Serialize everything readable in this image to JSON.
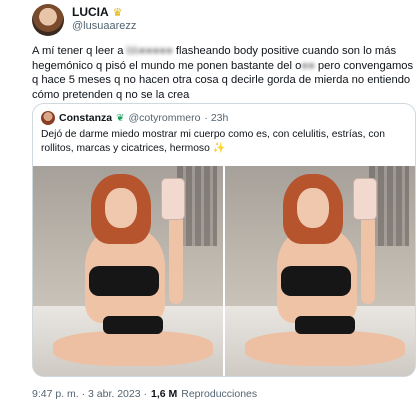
{
  "tweet": {
    "display_name": "LUCIA",
    "handle": "@lusuaarezz",
    "text_part1": "A mí tener q leer a ",
    "text_blur1": "b",
    "text_part2": " flasheando body positive cuando son lo más hegemónico q pisó el mundo me ponen bastante del o",
    "text_blur2": "",
    "text_part3": " pero convengamos q hace 5 meses q no hacen otra cosa q decirle gorda de mierda no entiendo cómo pretenden q no se la crea",
    "timestamp": "9:47 p. m. · 3 abr. 2023 ·",
    "views_count": "1,6 M",
    "views_label": "Reproducciones",
    "icons": {
      "crown": "crown-icon"
    }
  },
  "quote": {
    "display_name": "Constanza",
    "handle": "@cotyrommero",
    "age": "· 23h",
    "text": "Dejó de darme miedo mostrar mi cuerpo como es, con celulitis, estrías, con rollitos, marcas y cicatrices, hermoso",
    "icons": {
      "leaf": "leaf-icon",
      "sparkle": "sparkle-icon"
    }
  }
}
